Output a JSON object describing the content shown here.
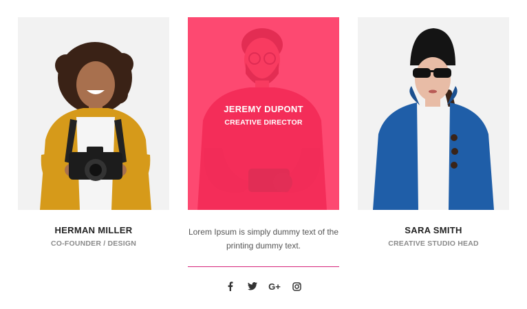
{
  "members": [
    {
      "name": "HERMAN MILLER",
      "role": "CO-FOUNDER / DESIGN"
    },
    {
      "name": "JEREMY DUPONT",
      "role": "CREATIVE DIRECTOR",
      "description": "Lorem Ipsum is simply dummy text of the printing dummy text.",
      "social": [
        {
          "icon": "facebook-icon"
        },
        {
          "icon": "twitter-icon"
        },
        {
          "icon": "google-plus-icon",
          "label": "G+"
        },
        {
          "icon": "instagram-icon"
        }
      ]
    },
    {
      "name": "SARA SMITH",
      "role": "CREATIVE STUDIO HEAD"
    }
  ],
  "colors": {
    "accent": "#ff2d5c",
    "divider": "#d4237a",
    "photo_bg": "#f2f2f2"
  }
}
